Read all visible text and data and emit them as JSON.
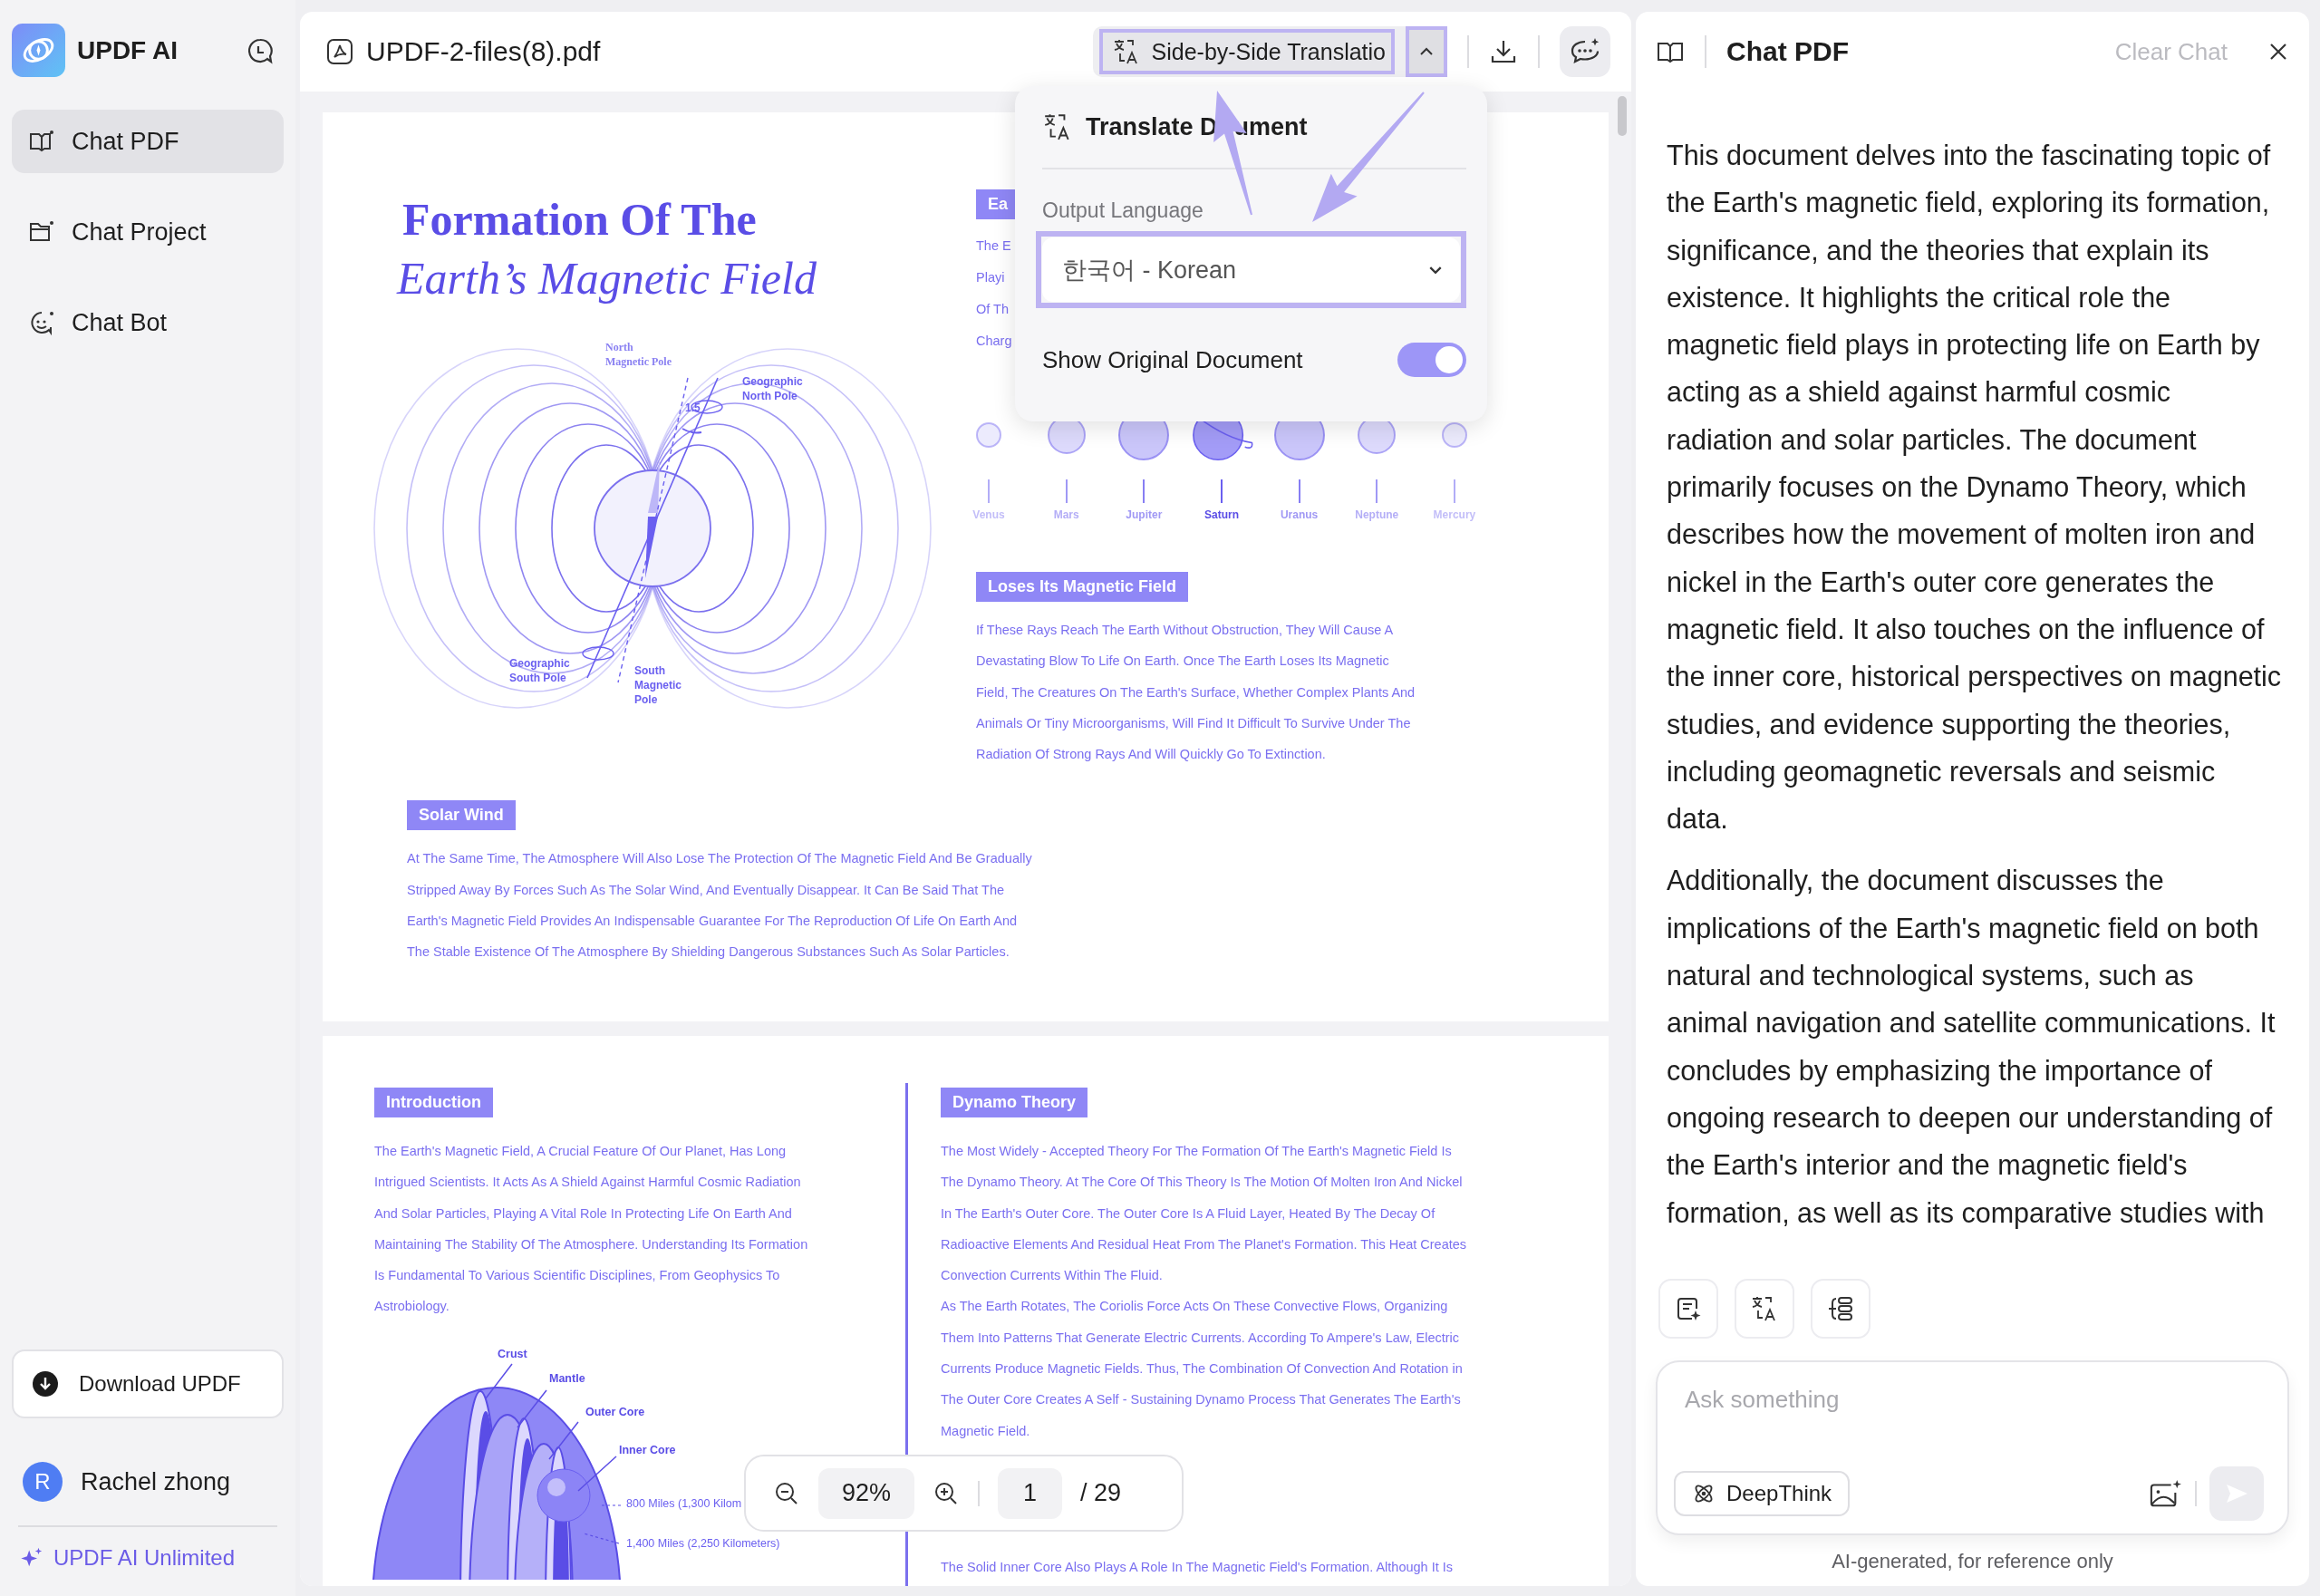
{
  "sidebar": {
    "app_name": "UPDF AI",
    "items": [
      {
        "label": "Chat PDF",
        "kind": "pdf",
        "selected": true
      },
      {
        "label": "Chat Project",
        "kind": "project",
        "selected": false
      },
      {
        "label": "Chat Bot",
        "kind": "bot",
        "selected": false
      }
    ],
    "download_button": "Download UPDF",
    "user": {
      "initial": "R",
      "name": "Rachel zhong"
    },
    "plan": "UPDF AI Unlimited"
  },
  "document": {
    "filename": "UPDF-2-files(8).pdf",
    "translate_button": "Side-by-Side Translatio",
    "page_1": {
      "title": "Formation Of The",
      "subtitle": "Earth’s Magnetic Field",
      "diagram_labels": [
        {
          "lines": [
            "North",
            "Magnetic Pole"
          ]
        },
        {
          "lines": [
            "Geographic",
            "North Pole"
          ]
        },
        {
          "lines": [
            "1.5"
          ]
        },
        {
          "lines": [
            "Geographic",
            "South Pole"
          ]
        },
        {
          "lines": [
            "South",
            "Magnetic",
            "Pole"
          ]
        }
      ],
      "side_heading": "Ea",
      "side_lines": [
        "The E",
        "Playi",
        "Of Th",
        "Charg"
      ],
      "planets": [
        {
          "name": "Venus",
          "kind": "plain"
        },
        {
          "name": "Mars",
          "kind": "plain"
        },
        {
          "name": "Jupiter",
          "kind": "plain"
        },
        {
          "name": "Saturn",
          "kind": "ringed"
        },
        {
          "name": "Uranus",
          "kind": "plain"
        },
        {
          "name": "Neptune",
          "kind": "plain"
        },
        {
          "name": "Mercury",
          "kind": "plain"
        }
      ],
      "sections": [
        {
          "heading": "Loses Its Magnetic Field",
          "lines": [
            "If These Rays Reach The Earth Without Obstruction, They Will Cause A",
            "Devastating Blow To Life On Earth. Once The Earth Loses Its Magnetic",
            "Field, The Creatures On The Earth's Surface, Whether Complex Plants And",
            "Animals Or Tiny Microorganisms, Will Find It Difficult To Survive Under The",
            "Radiation Of Strong Rays And Will Quickly Go To Extinction."
          ]
        },
        {
          "heading": "Solar Wind",
          "lines": [
            "At The Same Time, The Atmosphere Will Also Lose The Protection Of The Magnetic Field And Be Gradually",
            "Stripped Away By Forces Such As The Solar Wind, And Eventually Disappear. It Can Be Said That The",
            "Earth's Magnetic Field Provides An Indispensable Guarantee For The Reproduction Of Life On Earth And",
            "The Stable Existence Of The Atmosphere By Shielding Dangerous Substances Such As Solar Particles."
          ]
        }
      ]
    },
    "page_2": {
      "intro": {
        "heading": "Introduction",
        "lines": [
          "The Earth's Magnetic Field, A Crucial Feature Of Our Planet, Has Long",
          "Intrigued Scientists. It Acts As A Shield Against Harmful Cosmic Radiation",
          "And Solar Particles, Playing A Vital Role In Protecting Life On Earth And",
          "Maintaining The Stability Of The Atmosphere. Understanding Its Formation",
          "Is Fundamental To Various Scientific Disciplines, From Geophysics To",
          "Astrobiology."
        ]
      },
      "layer_labels": [
        "Crust",
        "Mantle",
        "Outer Core",
        "Inner Core"
      ],
      "distance_labels": [
        "800 Miles (1,300 Kilom",
        "1,400 Miles (2,250 Kilometers)"
      ],
      "theory": {
        "heading": "Dynamo Theory",
        "paragraphs": [
          [
            "The Most Widely - Accepted Theory For The Formation Of The Earth's Magnetic Field Is",
            "The Dynamo Theory. At The Core Of This Theory Is The Motion Of Molten Iron And Nickel",
            "In The Earth's Outer Core. The Outer Core Is A Fluid Layer, Heated By The Decay Of",
            "Radioactive Elements And Residual Heat From The Planet's Formation. This Heat Creates",
            "Convection Currents Within The Fluid."
          ],
          [
            "As The Earth Rotates, The Coriolis Force Acts On These Convective Flows, Organizing",
            "Them Into Patterns That Generate Electric Currents. According To Ampere's Law, Electric",
            "Currents Produce Magnetic Fields. Thus, The Combination Of Convection And Rotation in",
            "The Outer Core Creates A Self - Sustaining Dynamo Process That Generates The Earth's",
            "Magnetic Field."
          ]
        ],
        "last_line": "The Solid Inner Core Also Plays A Role In The Magnetic Field's Formation. Although It Is"
      }
    },
    "zoom": {
      "level": "92%",
      "page": "1",
      "total": "/ 29"
    }
  },
  "translate_popup": {
    "title": [
      "Translate D",
      "ument"
    ],
    "label": "Output Language",
    "language": "한국어 - Korean",
    "show_original": {
      "label": "Show Original Document",
      "on": true
    }
  },
  "chat": {
    "title": "Chat PDF",
    "clear": "Clear Chat",
    "paragraphs": [
      "This document delves into the fascinating topic of the Earth's magnetic field, exploring its formation, significance, and the theories that explain its existence. It highlights the critical role the magnetic field plays in protecting life on Earth by acting as a shield against harmful cosmic radiation and solar particles. The document primarily focuses on the Dynamo Theory, which describes how the movement of molten iron and nickel in the Earth's outer core generates the magnetic field. It also touches on the influence of the inner core, historical perspectives on magnetic studies, and evidence supporting the theories, including geomagnetic reversals and seismic data.",
      "Additionally, the document discusses the implications of the Earth's magnetic field on both natural and technological systems, such as animal navigation and satellite communications. It concludes by emphasizing the importance of ongoing research to deepen our understanding of the Earth's interior and the magnetic field's formation, as well as its comparative studies with"
    ],
    "placeholder": "Ask something",
    "deepthink": "DeepThink",
    "footer": "AI-generated, for reference only"
  }
}
